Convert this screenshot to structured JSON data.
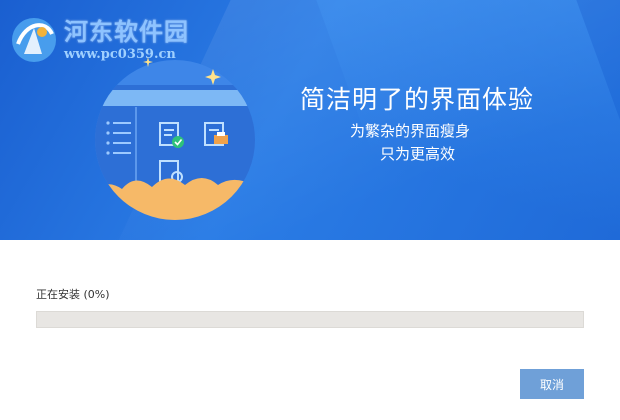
{
  "watermark": {
    "site_name": "河东软件园",
    "site_url": "www.pc0359.cn"
  },
  "banner": {
    "headline": "简洁明了的界面体验",
    "subline1": "为繁杂的界面瘦身",
    "subline2": "只为更高效"
  },
  "install": {
    "status_label": "正在安装",
    "progress_text": "(0%)",
    "progress": 0
  },
  "buttons": {
    "cancel_label": "取消"
  },
  "colors": {
    "banner_blue": "#1f6ad8",
    "illustration_circle": "#3e86e8",
    "cloud_orange": "#f6b968",
    "check_green": "#2fc27a",
    "cancel_button": "#6fa0d8",
    "progress_track": "#e8e6e3"
  },
  "icons": [
    "watermark-logo-icon",
    "sparkle-icon",
    "document-check-icon",
    "document-print-icon",
    "list-icon"
  ]
}
